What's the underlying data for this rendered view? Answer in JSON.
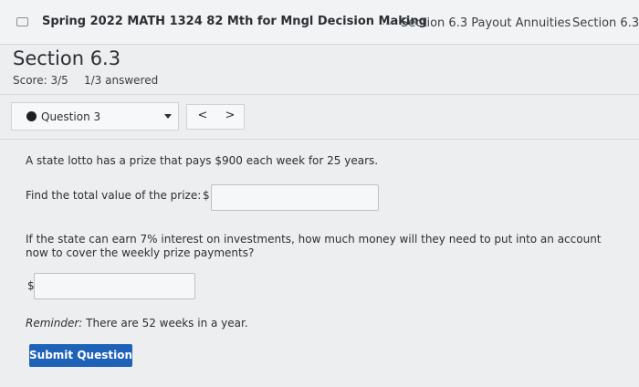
{
  "header": {
    "course_title": "Spring 2022 MATH 1324 82 Mth for Mngl Decision Making",
    "ellipsis": "...",
    "breadcrumb_current": "Section 6.3 Payout Annuities",
    "breadcrumb_next": "Section 6.3"
  },
  "section": {
    "title": "Section 6.3",
    "score": "Score: 3/5",
    "answered": "1/3 answered"
  },
  "question_nav": {
    "selected": "Question 3",
    "prev_glyph": "<",
    "next_glyph": ">"
  },
  "problem": {
    "statement": "A state lotto has a prize that pays $900 each week for 25 years.",
    "find_total_label": "Find the total value of the prize: $",
    "find_total_value": "",
    "interest_question": "If the state can earn 7% interest on investments, how much money will they need to put into an account now to cover the weekly prize payments?",
    "currency_symbol": "$",
    "deposit_value": "",
    "reminder_label": "Reminder:",
    "reminder_text": "There are 52 weeks in a year."
  },
  "actions": {
    "submit_label": "Submit Question"
  },
  "colors": {
    "accent": "#1e62b8",
    "background": "#eceef0"
  },
  "icons": {
    "menu": "window-icon",
    "question_status": "filled-circle-icon",
    "dropdown": "caret-down-icon"
  }
}
